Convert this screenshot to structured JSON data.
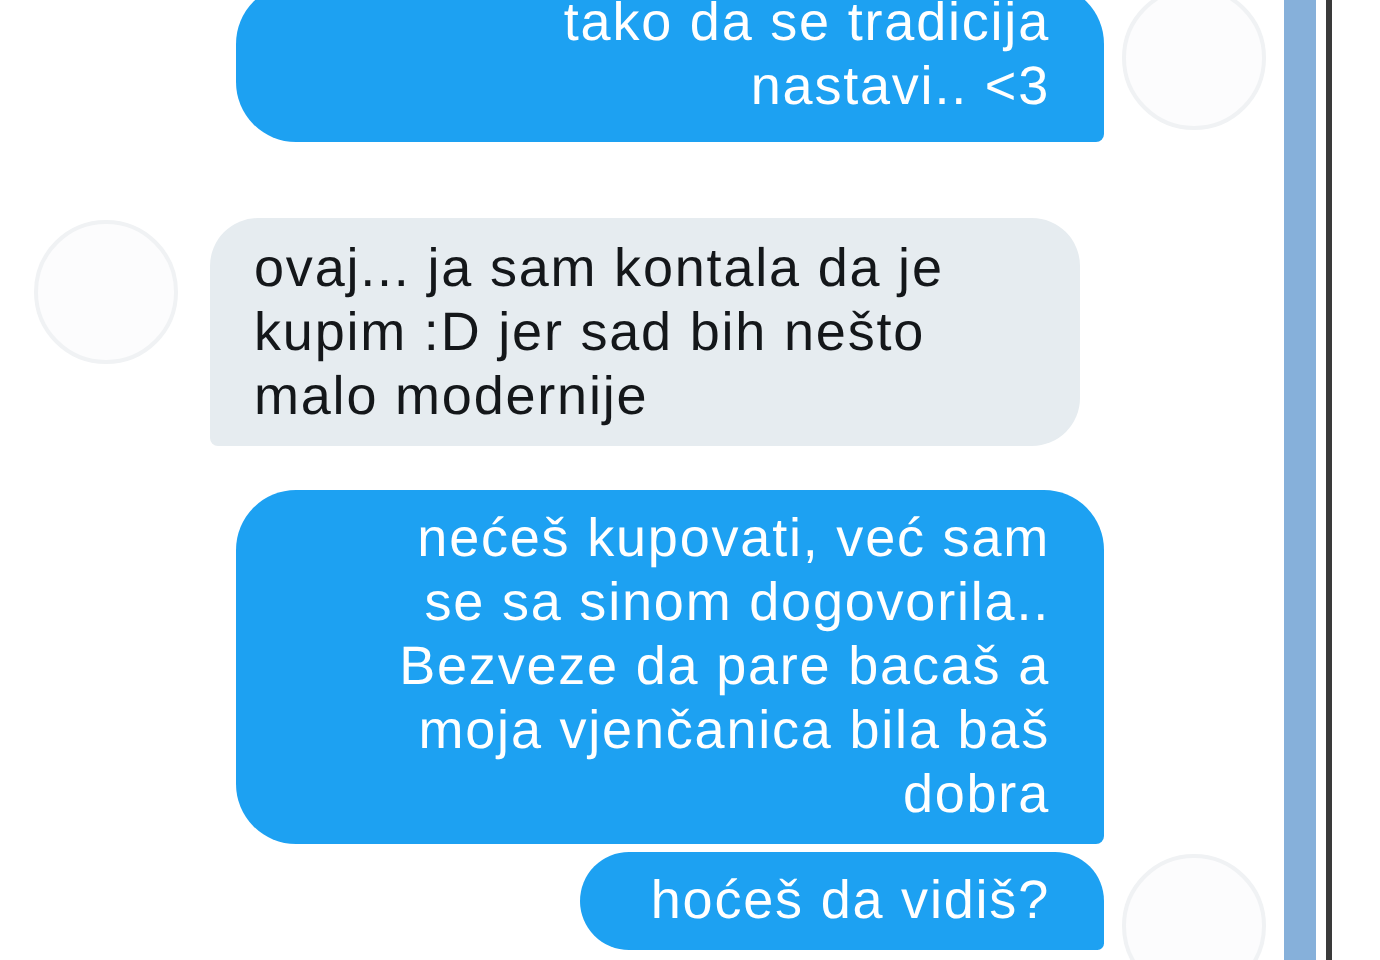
{
  "messages": [
    {
      "kind": "sent",
      "lines": [
        "tako da se tradicija",
        "nastavi.. <3"
      ],
      "avatar": true
    },
    {
      "kind": "received",
      "lines": [
        "ovaj... ja sam kontala da je",
        "kupim :D jer sad bih nešto",
        "malo modernije"
      ],
      "avatar": true
    },
    {
      "kind": "sent",
      "lines": [
        "nećeš kupovati, već sam",
        "se sa sinom dogovorila..",
        "Bezveze da pare bacaš a",
        "moja vjenčanica bila baš",
        "dobra"
      ],
      "avatar": false
    },
    {
      "kind": "sent",
      "lines": [
        "hoćeš da vidiš?"
      ],
      "avatar": true
    }
  ]
}
